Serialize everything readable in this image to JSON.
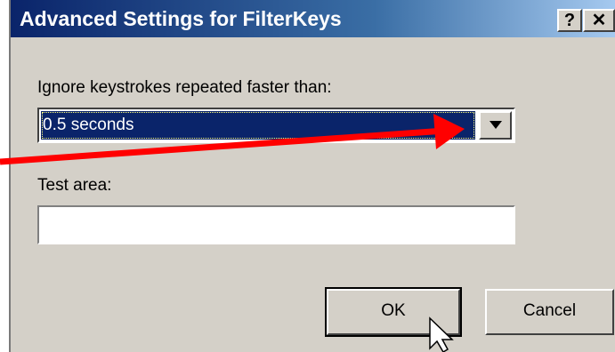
{
  "window": {
    "title": "Advanced Settings for FilterKeys",
    "help_label": "?",
    "close_label": "✕"
  },
  "form": {
    "ignore_label": "Ignore keystrokes repeated faster than:",
    "ignore_value": "0.5 seconds",
    "test_label": "Test area:",
    "test_value": ""
  },
  "buttons": {
    "ok": "OK",
    "cancel": "Cancel"
  },
  "colors": {
    "title_bar": "#0a246a",
    "dialog_bg": "#d4d0c8",
    "selection": "#0a246a",
    "annotation_arrow": "#ff0000"
  }
}
